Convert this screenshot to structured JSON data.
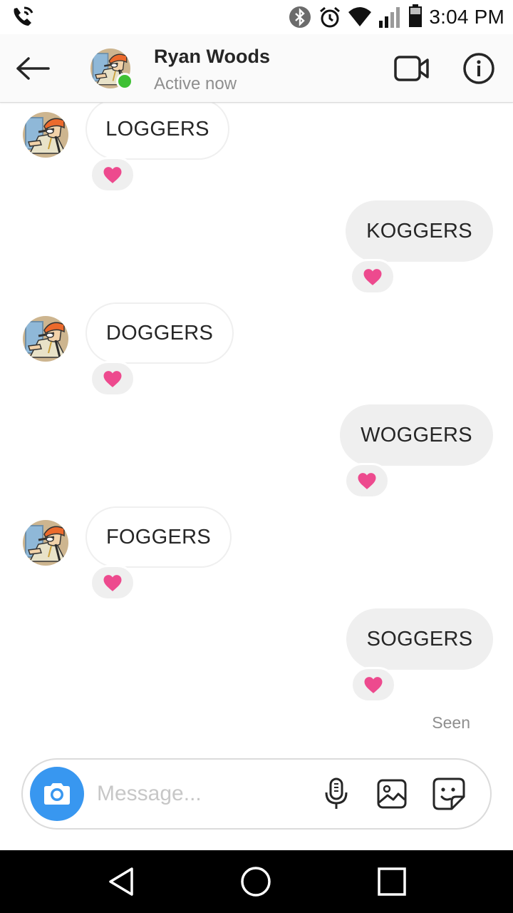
{
  "status_bar": {
    "time": "3:04 PM",
    "icons": [
      "wifi-calling-icon",
      "bluetooth-icon",
      "alarm-icon",
      "wifi-icon",
      "signal-icon",
      "battery-icon"
    ]
  },
  "header": {
    "contact_name": "Ryan Woods",
    "contact_status": "Active now",
    "icons": [
      "back-arrow-icon",
      "video-call-icon",
      "info-icon"
    ]
  },
  "messages": [
    {
      "direction": "incoming",
      "text": "LOGGERS",
      "reaction": "heart"
    },
    {
      "direction": "outgoing",
      "text": "KOGGERS",
      "reaction": "heart"
    },
    {
      "direction": "incoming",
      "text": "DOGGERS",
      "reaction": "heart"
    },
    {
      "direction": "outgoing",
      "text": "WOGGERS",
      "reaction": "heart"
    },
    {
      "direction": "incoming",
      "text": "FOGGERS",
      "reaction": "heart"
    },
    {
      "direction": "outgoing",
      "text": "SOGGERS",
      "reaction": "heart"
    }
  ],
  "seen_label": "Seen",
  "composer": {
    "placeholder": "Message...",
    "icons": [
      "camera-icon",
      "microphone-icon",
      "gallery-icon",
      "sticker-icon"
    ]
  },
  "colors": {
    "accent": "#3897f0",
    "online": "#3ec034",
    "heart": "#ed4a8e",
    "bubble_out": "#efefef",
    "secondary_text": "#8e8e8e"
  },
  "nav_icons": [
    "back-triangle-icon",
    "home-circle-icon",
    "recents-square-icon"
  ]
}
